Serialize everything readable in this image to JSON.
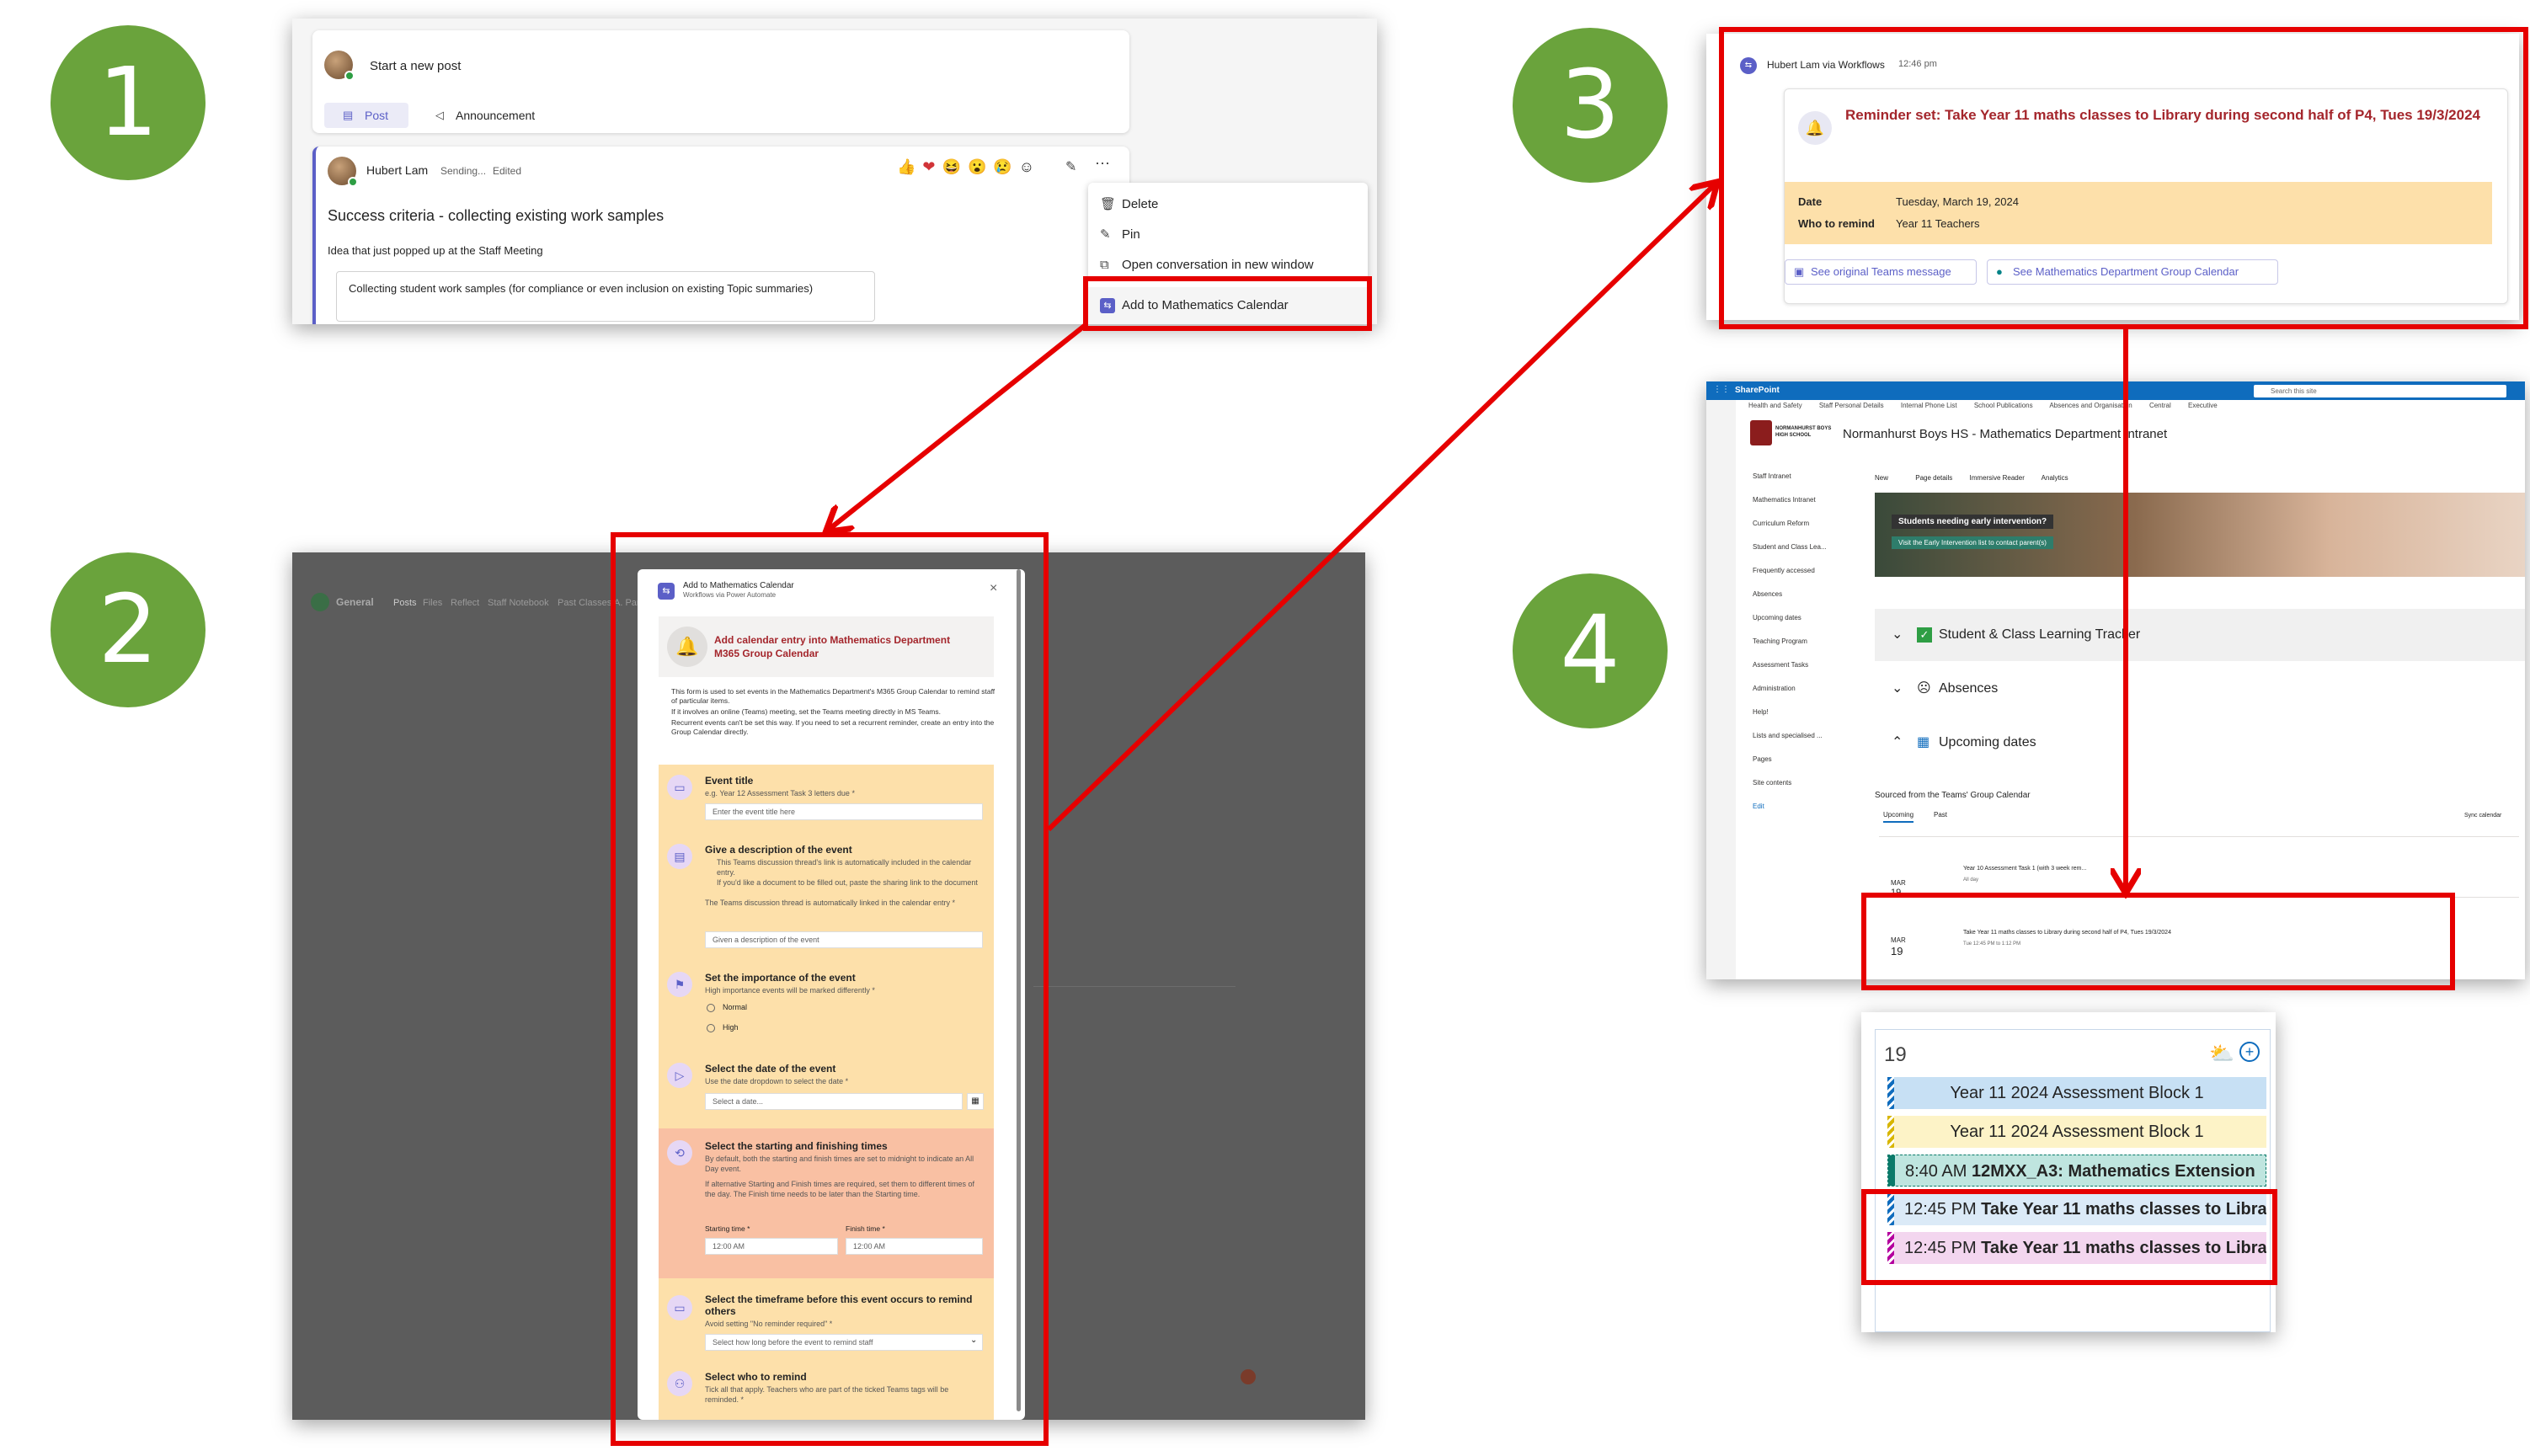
{
  "steps": [
    "1",
    "2",
    "3",
    "4"
  ],
  "panel1": {
    "start_post": "Start a new post",
    "tab_post": "Post",
    "tab_announcement": "Announcement",
    "author": "Hubert Lam",
    "status": "Sending...",
    "edited": "Edited",
    "reactions": [
      "👍",
      "❤",
      "😆",
      "😮",
      "😢",
      "☺"
    ],
    "post_title": "Success criteria - collecting existing work samples",
    "post_body": "Idea that just popped up at the Staff Meeting",
    "quote": "Collecting student work samples (for compliance or even inclusion on existing Topic summaries)",
    "menu": {
      "delete": "Delete",
      "pin": "Pin",
      "open_new": "Open conversation in new window",
      "add_calendar": "Add to Mathematics Calendar"
    }
  },
  "panel2": {
    "channel": "General",
    "channel_tabs": [
      "Posts",
      "Files",
      "Reflect",
      "Staff Notebook",
      "Past Classes",
      "A. Par"
    ],
    "dialog_title": "Add to Mathematics Calendar",
    "dialog_subtitle": "Workflows via Power Automate",
    "close": "×",
    "header": "Add calendar entry into Mathematics Department M365 Group Calendar",
    "bullets": [
      "This form is used to set events in the Mathematics Department's M365 Group Calendar to remind staff of particular items.",
      "If it involves an online (Teams) meeting, set the Teams meeting directly in MS Teams.",
      "Recurrent events can't be set this way. If you need to set a recurrent reminder, create an entry into the Group Calendar directly."
    ],
    "q_title": "Event title",
    "q_title_sub": "e.g. Year 12 Assessment Task 3 letters due *",
    "q_title_ph": "Enter the event title here",
    "q_desc": "Give a description of the event",
    "q_desc_sub1": "This Teams discussion thread's link is automatically included in the calendar entry.",
    "q_desc_sub2": "If you'd like a document to be filled out, paste the sharing link to the document",
    "q_desc_sub3": "The Teams discussion thread is automatically linked in the calendar entry *",
    "q_desc_ph": "Given a description of the event",
    "q_imp": "Set the importance of the event",
    "q_imp_sub": "High importance events will be marked differently *",
    "opt_normal": "Normal",
    "opt_high": "High",
    "q_date": "Select the date of the event",
    "q_date_sub": "Use the date dropdown to select the date *",
    "q_date_ph": "Select a date...",
    "q_times": "Select the starting and finishing times",
    "q_times_sub": "By default, both the starting and finish times are set to midnight to indicate an All Day event.",
    "q_times_sub2": "If alternative Starting and Finish times are required, set them to different times of the day. The Finish time needs to be later than the Starting time.",
    "start_label": "Starting time *",
    "finish_label": "Finish time *",
    "start_val": "12:00 AM",
    "finish_val": "12:00 AM",
    "q_remind": "Select the timeframe before this event occurs to remind others",
    "q_remind_sub": "Avoid setting \"No reminder required\" *",
    "q_remind_ph": "Select how long before the event to remind staff",
    "q_who": "Select who to remind",
    "q_who_sub": "Tick all that apply. Teachers who are part of the ticked Teams tags will be reminded. *"
  },
  "panel3": {
    "sender": "Hubert Lam via Workflows",
    "time": "12:46 pm",
    "reminder": "Reminder set: Take Year 11 maths classes to Library during second half of P4, Tues 19/3/2024",
    "date_label": "Date",
    "date_value": "Tuesday, March 19, 2024",
    "who_label": "Who to remind",
    "who_value": "Year 11 Teachers",
    "btn_original": "See original Teams message",
    "btn_calendar": "See Mathematics Department Group Calendar"
  },
  "panel4": {
    "app": "SharePoint",
    "search": "Search this site",
    "links": [
      "Health and Safety",
      "Staff Personal Details",
      "Internal Phone List",
      "School Publications",
      "Absences and Organisation",
      "Central",
      "Executive"
    ],
    "school": "NORMANHURST BOYS HIGH SCHOOL",
    "site_title": "Normanhurst Boys HS - Mathematics Department Intranet",
    "toolbar": [
      "New",
      "Page details",
      "Immersive Reader",
      "Analytics"
    ],
    "nav": [
      "Staff Intranet",
      "Mathematics Intranet",
      "Curriculum Reform",
      "Student and Class Lea...",
      "Frequently accessed",
      "Absences",
      "Upcoming dates",
      "Teaching Program",
      "Assessment Tasks",
      "Administration",
      "Help!",
      "Lists and specialised ...",
      "Pages",
      "Site contents",
      "Edit"
    ],
    "banner_q": "Students needing early intervention?",
    "banner_link": "Visit the Early Intervention list to contact parent(s)",
    "acc1": "Student & Class Learning Tracker",
    "acc2": "Absences",
    "acc3": "Upcoming dates",
    "sourced": "Sourced from the Teams' Group Calendar",
    "tab_upcoming": "Upcoming",
    "tab_past": "Past",
    "sync": "Sync calendar",
    "ev1_month": "MAR",
    "ev1_day": "19",
    "ev1_title": "Year 10 Assessment Task 1 (with 3 week rem...",
    "ev1_time": "All day",
    "ev2_month": "MAR",
    "ev2_day": "19",
    "ev2_title": "Take Year 11 maths classes to Library during second half of P4, Tues 19/3/2024",
    "ev2_time": "Tue 12:45 PM to 1:12 PM"
  },
  "panel5": {
    "day": "19",
    "events": [
      {
        "time": "",
        "title": "Year 11 2024 Assessment Block 1"
      },
      {
        "time": "",
        "title": "Year 11 2024 Assessment Block 1"
      },
      {
        "time": "8:40 AM",
        "title": "12MXX_A3: Mathematics Extension"
      },
      {
        "time": "12:45 PM",
        "title": "Take Year 11 maths classes to Libra"
      },
      {
        "time": "12:45 PM",
        "title": "Take Year 11 maths classes to Libra"
      }
    ]
  },
  "colors": {
    "step": "#6aa33c",
    "highlight": "#e60000",
    "teams": "#5b5fc7",
    "reminder": "#a4262c"
  }
}
